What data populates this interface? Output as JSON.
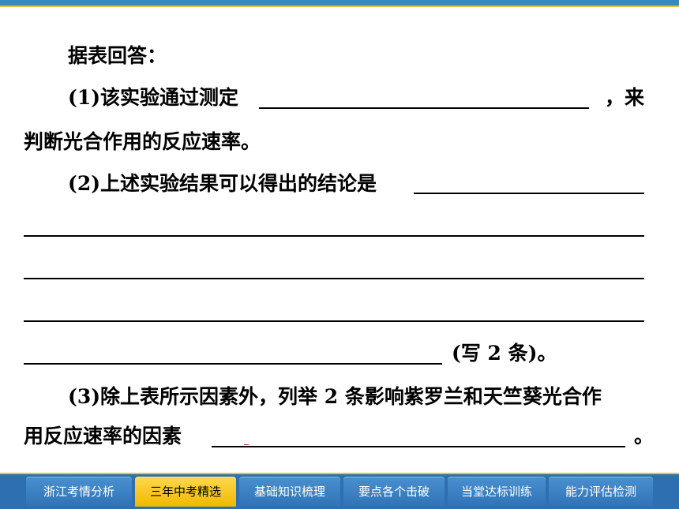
{
  "content": {
    "intro": "据表回答：",
    "q1_part1": "(1)该实验通过测定",
    "q1_part2": "，来",
    "q1_line2": "判断光合作用的反应速率。",
    "q2_part1": "(2)上述实验结果可以得出的结论是",
    "q2_tail": "(写 2 条)。",
    "q3_line1": "(3)除上表所示因素外，列举 2 条影响紫罗兰和天竺葵光合作",
    "q3_line2": "用反应速率的因素",
    "q3_end": "。"
  },
  "nav": {
    "tabs": [
      {
        "label": "浙江考情分析"
      },
      {
        "label": "三年中考精选"
      },
      {
        "label": "基础知识梳理"
      },
      {
        "label": "要点各个击破"
      },
      {
        "label": "当堂达标训练"
      },
      {
        "label": "能力评估检测"
      }
    ],
    "active_index": 1,
    "active_color": "#f5c518",
    "bar_color": "#2d6fb0"
  }
}
